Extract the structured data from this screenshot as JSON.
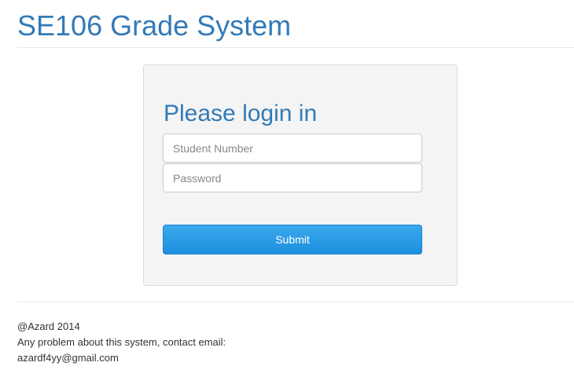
{
  "header": {
    "title": "SE106 Grade System"
  },
  "login": {
    "heading": "Please login in",
    "student_number_placeholder": "Student Number",
    "student_number_value": "",
    "password_placeholder": "Password",
    "password_value": "",
    "submit_label": "Submit"
  },
  "footer": {
    "copyright": "@Azard 2014",
    "contact_line": "Any problem about this system, contact email:",
    "email": "azardf4yy@gmail.com"
  },
  "colors": {
    "accent": "#337ab7",
    "button": "#2196e3",
    "card_background": "#f4f4f4"
  }
}
